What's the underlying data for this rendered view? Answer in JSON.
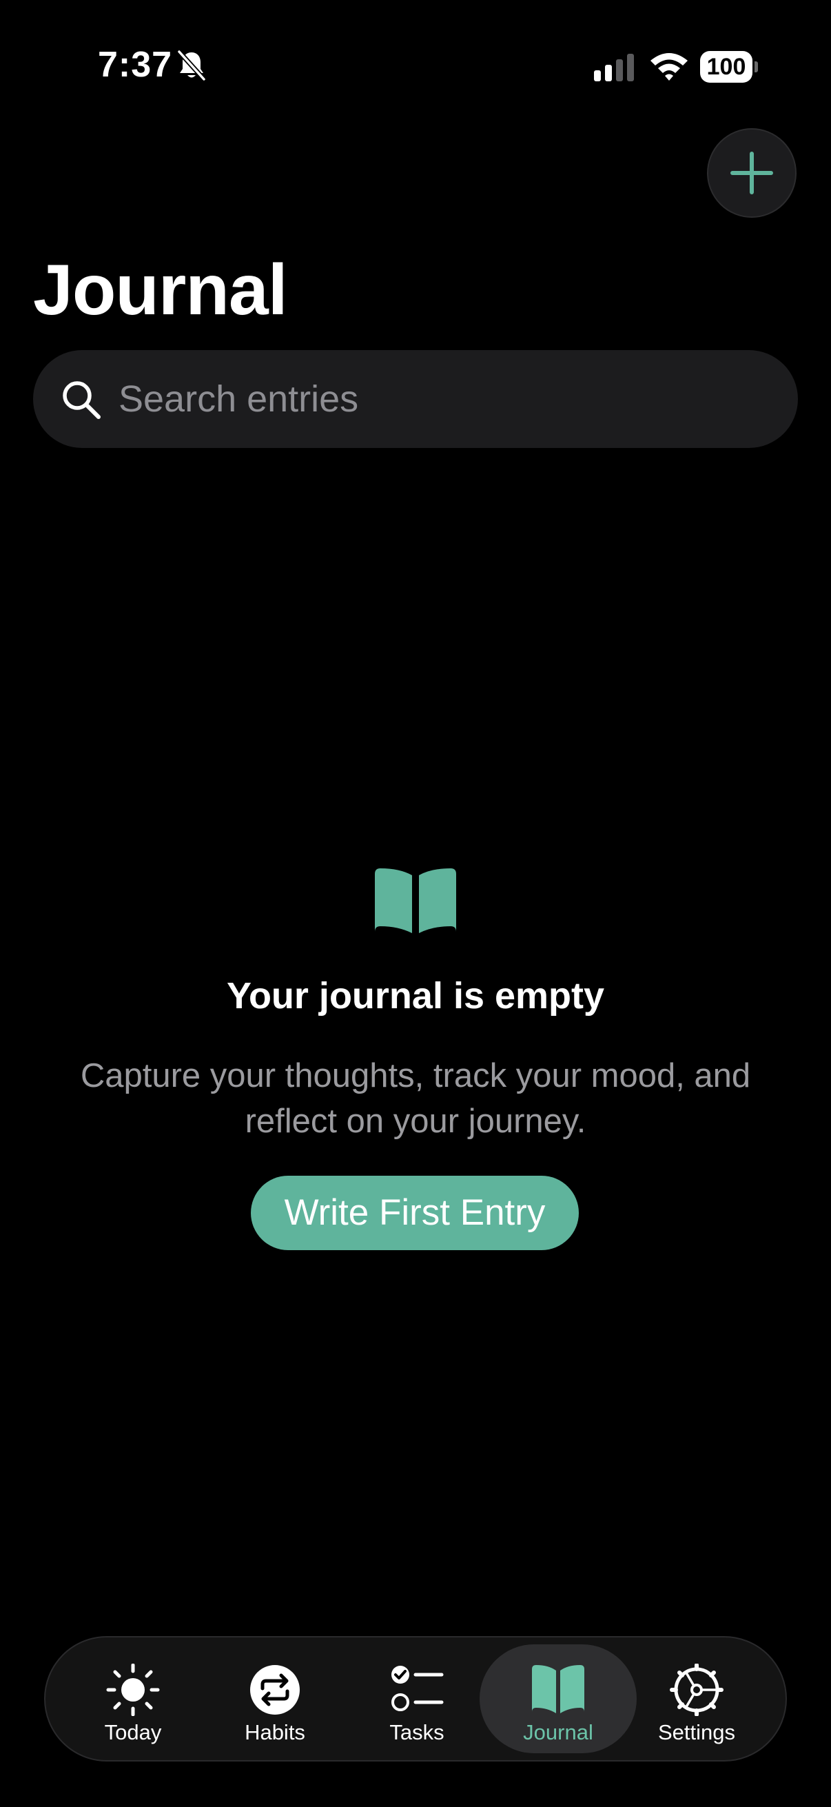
{
  "status_bar": {
    "time": "7:37",
    "battery": "100"
  },
  "header": {
    "title": "Journal",
    "add_icon": "plus-icon"
  },
  "search": {
    "placeholder": "Search entries",
    "value": "",
    "icon": "search-icon"
  },
  "empty_state": {
    "icon": "book-icon",
    "title": "Your journal is empty",
    "subtitle": "Capture your thoughts, track your mood, and reflect on your journey.",
    "button_label": "Write First Entry"
  },
  "tab_bar": {
    "items": [
      {
        "label": "Today",
        "icon": "sun-icon"
      },
      {
        "label": "Habits",
        "icon": "repeat-icon"
      },
      {
        "label": "Tasks",
        "icon": "checklist-icon"
      },
      {
        "label": "Journal",
        "icon": "book-icon",
        "active": true
      },
      {
        "label": "Settings",
        "icon": "gear-icon"
      }
    ]
  },
  "colors": {
    "accent": "#5fb49c",
    "accent_light": "#6cc4a9",
    "background": "#000000",
    "surface": "#1c1c1e"
  }
}
